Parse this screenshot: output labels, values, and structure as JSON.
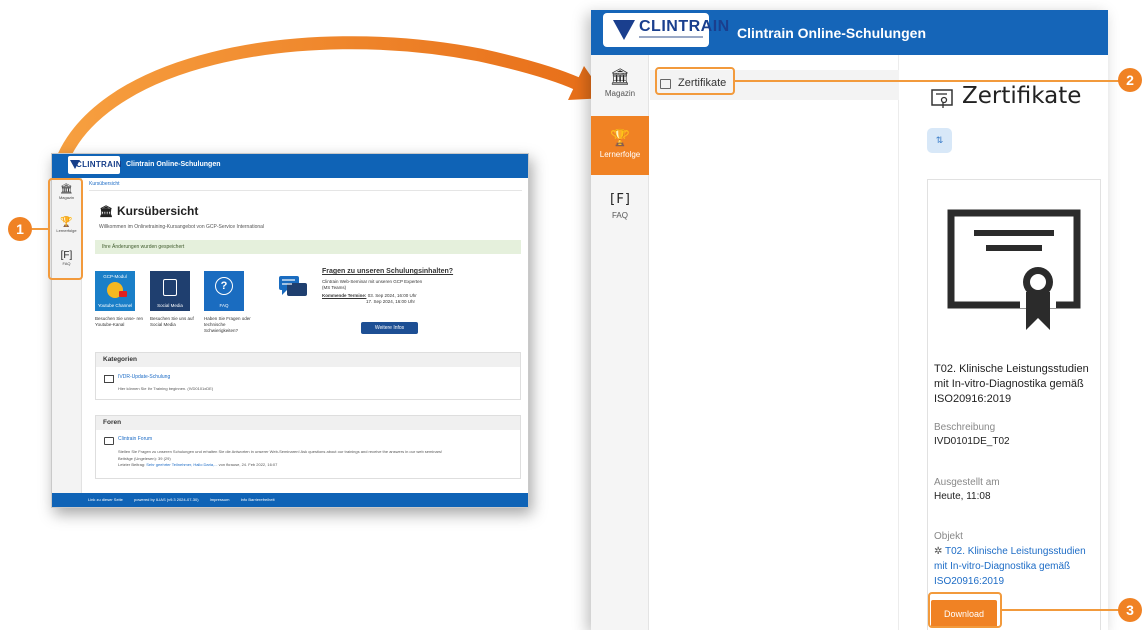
{
  "app": {
    "logo_text": "CLINTRAIN",
    "title": "Clintrain Online-Schulungen"
  },
  "small": {
    "breadcrumb": "Kursübersicht",
    "page_title": "Kursübersicht",
    "subtitle": "Willkommen im Onlinetraining-Kursangebot von GCP-Service International",
    "notice": "Ihre Änderungen wurden gespeichert",
    "rail": [
      {
        "label": "Magazin",
        "icon": "building-icon"
      },
      {
        "label": "Lernerfolge",
        "icon": "trophy-icon"
      },
      {
        "label": "FAQ",
        "icon": "faq-icon"
      }
    ],
    "tiles": [
      {
        "label": "Youtube Channel",
        "top_label": "GCP-Modul",
        "caption": "Besuchen Sie unse- ren Youtube-Kanal",
        "color": "#1a7fc8"
      },
      {
        "label": "Social Media",
        "caption": "Besuchen Sie uns auf Social Media",
        "color": "#1f3f6f"
      },
      {
        "label": "FAQ",
        "caption": "Haben Sie Fragen oder technische Schwierigkeiten?",
        "color": "#1a6cc0"
      }
    ],
    "faq_promo": {
      "heading": "Fragen zu unseren Schulungsinhalten?",
      "line1": "Clintrain Web-Seminar mit unseren GCP Experten",
      "line2": "(MS Teams)",
      "dates_label": "Kommende Termine:",
      "date1": "03. Sep 2024, 16:00 Uhr",
      "date2": "17. Sep 2024, 16:00 Uhr",
      "button": "Weitere Infos"
    },
    "categories": {
      "heading": "Kategorien",
      "item_link": "IVDR-Update-Schulung",
      "item_desc": "Hier können Sie Ihr Training beginnen. (IVD0101xDE)"
    },
    "forums": {
      "heading": "Foren",
      "item_link": "Clintrain Forum",
      "item_desc": "Stellen Sie Fragen zu unseren Schulungen und erhalten Sie die Antworten in unserer Web-Seminaren! Ask questions about our trainings and receive the answers in our web seminars!",
      "posts": "Beiträge (Ungelesen): 39 (29)",
      "last_post_prefix": "Letzter Beitrag:",
      "last_post_link": "Sehr geehrter Teilnehmer, Hallo Daria,...",
      "last_post_suffix": "von fkrause, 24. Feb 2022, 16:07"
    },
    "footer": [
      "Link zu dieser Seite",
      "powered by ILIAS (v9.3 2024-07-30)",
      "Impressum",
      "Info Barrierefreiheit"
    ]
  },
  "big": {
    "rail": [
      {
        "label": "Magazin",
        "icon": "building-icon",
        "glyph": "🏛"
      },
      {
        "label": "Lernerfolge",
        "icon": "trophy-icon",
        "glyph": "🏆",
        "active": true
      },
      {
        "label": "FAQ",
        "icon": "faq-icon",
        "glyph": "[F]"
      }
    ],
    "tree_item": "Zertifikate",
    "page_title": "Zertifikate",
    "sort_icon": "⇅",
    "card": {
      "title": "T02. Klinische Leistungsstudien mit In-vitro-Diagnostika gemäß ISO20916:2019",
      "desc_label": "Beschreibung",
      "desc_value": "IVD0101DE_T02",
      "issued_label": "Ausgestellt am",
      "issued_value": "Heute, 11:08",
      "object_label": "Objekt",
      "object_link": "T02. Klinische Leistungsstudien mit In-vitro-Diagnostika gemäß ISO20916:2019",
      "download": "Download"
    }
  },
  "markers": [
    "1",
    "2",
    "3"
  ],
  "colors": {
    "brand_blue": "#1565b8",
    "accent_orange": "#f08224",
    "highlight": "#f29a3c"
  }
}
